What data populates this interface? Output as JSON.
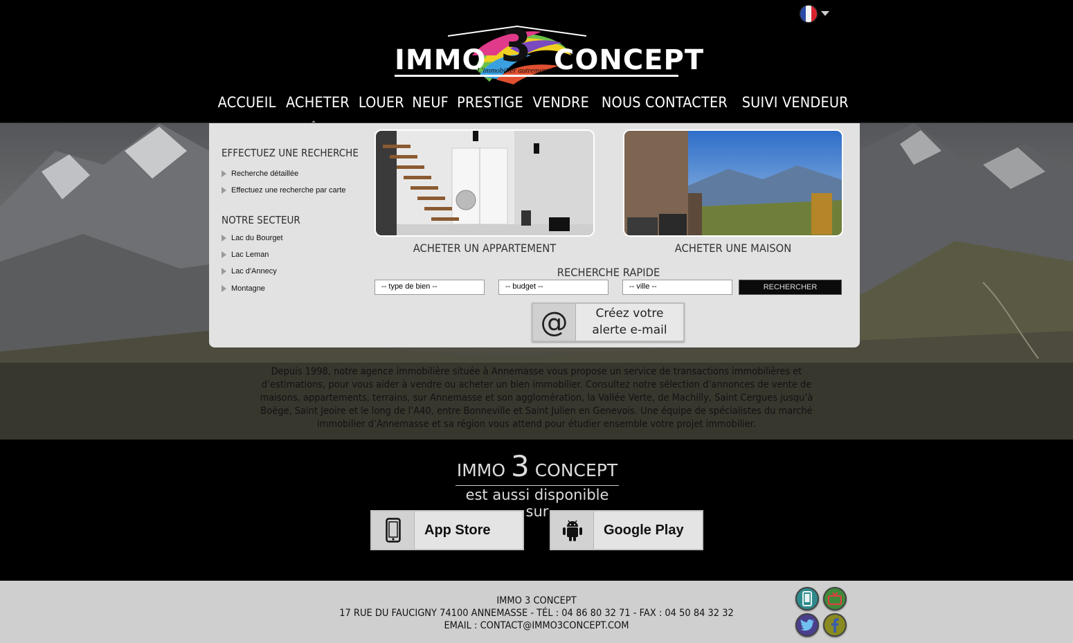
{
  "language": {
    "current": "French",
    "flag_icon": "france-flag-icon"
  },
  "brand": {
    "word1": "IMMO",
    "number": "3",
    "word2": "CONCEPT",
    "tagline": "L'immobilier autrement"
  },
  "nav": [
    {
      "label": "ACCUEIL",
      "active": false
    },
    {
      "label": "ACHETER",
      "active": true
    },
    {
      "label": "LOUER",
      "active": false
    },
    {
      "label": "NEUF",
      "active": false
    },
    {
      "label": "PRESTIGE",
      "active": false
    },
    {
      "label": "VENDRE",
      "active": false
    },
    {
      "label": "NOUS CONTACTER",
      "active": false
    },
    {
      "label": "SUIVI VENDEUR",
      "active": false
    }
  ],
  "dropdown": {
    "search_heading": "EFFECTUEZ UNE RECHERCHE",
    "search_links": [
      "Recherche détaillée",
      "Effectuez une recherche par carte"
    ],
    "sector_heading": "NOTRE SECTEUR",
    "sector_links": [
      "Lac du Bourget",
      "Lac Leman",
      "Lac d'Annecy",
      "Montagne"
    ],
    "cards": [
      {
        "caption": "ACHETER UN APPARTEMENT"
      },
      {
        "caption": "ACHETER UNE MAISON"
      }
    ],
    "quick_search": {
      "title": "RECHERCHE RAPIDE",
      "type_select": "-- type de bien --",
      "budget_select": "-- budget --",
      "city_select": "-- ville --",
      "button": "RECHERCHER"
    },
    "alert": {
      "line1": "Créez votre",
      "line2": "alerte e-mail",
      "icon": "at-sign-icon"
    }
  },
  "intro": "Depuis 1998, notre agence immobilière située à Annemasse vous propose un service de transactions immobilières et d’estimations, pour vous aider à vendre ou acheter un bien immobilier. Consultez notre sélection d’annonces de vente de maisons, appartements, terrains, sur Annemasse et son agglomération, la Vallée Verte, de Machilly, Saint Cergues jusqu’à Boëge, Saint Jeoire et le long de l’A40, entre Bonneville et Saint Julien en Genevois. Une équipe de spécialistes du marché immobilier d’Annemasse et sa région vous attend pour étudier ensemble votre projet immobilier.",
  "apps": {
    "brand_word1": "IMMO",
    "brand_number": "3",
    "brand_word2": "CONCEPT",
    "subtitle": "est aussi disponible sur",
    "app_store": "App Store",
    "google_play": "Google Play"
  },
  "footer": {
    "line1": "IMMO 3 CONCEPT",
    "line2": "17 RUE DU FAUCIGNY 74100 ANNEMASSE  -  TÉL : 04 86 80 32 71 - FAX : 04 50 84 32 32",
    "line3": "EMAIL : CONTACT@IMMO3CONCEPT.COM"
  },
  "social": [
    {
      "icon": "mobile-icon",
      "color": "#2f8a8c"
    },
    {
      "icon": "tv-icon",
      "color": "#3e8a3a"
    },
    {
      "icon": "twitter-icon",
      "color": "#4a3f8c"
    },
    {
      "icon": "facebook-icon",
      "color": "#8a8a20"
    }
  ]
}
